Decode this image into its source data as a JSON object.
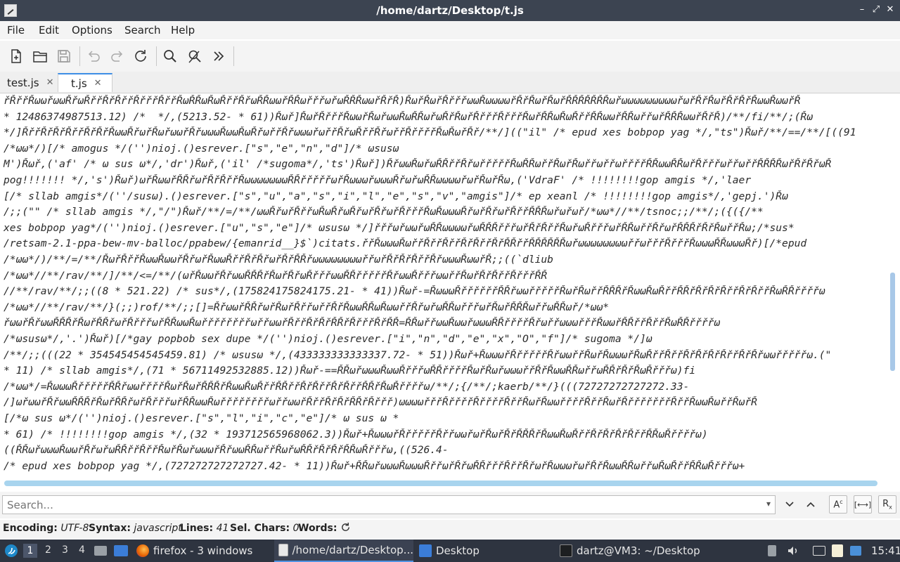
{
  "window": {
    "title": "/home/dartz/Desktop/t.js",
    "minimize": "–",
    "maximize": "⤢",
    "close": "✕"
  },
  "menu": {
    "file": "File",
    "edit": "Edit",
    "options": "Options",
    "search": "Search",
    "help": "Help"
  },
  "toolbar": {
    "icons": [
      "new-file-icon",
      "open-folder-icon",
      "save-icon",
      "undo-icon",
      "redo-icon",
      "reload-icon",
      "find-icon",
      "replace-icon",
      "more-icon"
    ]
  },
  "tabs": [
    {
      "label": "test.js",
      "close": "✕"
    },
    {
      "label": "t.js",
      "close": "✕"
    }
  ],
  "editor": {
    "lines": [
      "řŘřřŘωωřωωŘřωŘřřŘřŘřřŘřřřŘřřŘωŘŘωŘωŘřřŘřωŘŘωωřŘŘωřřřωřωŘŘŘωωřŘřŘ)ŘωřŘωřŘřřřωωŘωωωωřŘřŘωřŘωřŘŘŘŘŘŘŘωřωωωωωωωωωřωřŘřŘωřŘřŘřŘωωŘωωřŘ",
      "* 12486374987513.12) /*  */,(5213.52- * 61))Řωř]ŘωřŘřřřŘωωřŘωřωωŘωŘŘωřωŘřŘωřŘřřřŘřřřŘωřŘŘωŘωŘřřŘŘωωřŘŘωřřωřŘŘŘωωřŘřŘ)/**/fi/**/;(Řω",
      "*/]ŘřřŘřŘřŘřřŘřŘřŘωωŘřωřŘωřωωřŘřωωωŘωωŘωŘřωřřŘřωωωřωřřŘřωŘřřŘřωřřŘřřřřŘωŘωřŘř/**/]((\"il\" /* epud xes bobpop yag */,\"ts\")Řωř/**/==/**/[((91",
      "/*ωω*/)[/* amogus */('')nioj.()esrever.[\"s\",\"e\",\"n\",\"d\"]/* ωsusω",
      "M')Řωř,('af' /* ω sus ω*/,'dr')Řωř,('il' /*sugoma*/,'ts')Řωř])ŘřωωŘωřωŘŘřřŘřωřřřřřŘωŘŘωřřŘωřŘωřřωřřωřřřřŘŘωωŘŘωřŘřřřωřřωřřŘŘŘŘωřŘřŘřωŘ",
      "pog!!!!!!! */,'s')Řωř)ωřŘωωřŘŘřωřŘřŘřřŘωωωωωωωŘŘřřřřřωřŘωωωřωωωŘřωřωŘŘωωωωřωřŘωřŘω,('VdraF' /* !!!!!!!!gop amgis */,'laer",
      "[/* sllab amgis*/(''/susω).()esrever.[\"s\",\"u\",\"a\",\"s\",\"i\",\"l\",\"e\",\"s\",\"v\",\"amgis\"]/* ep xeanl /* !!!!!!!!gop amgis*/,'gepj.')Řω",
      "/;;(\"\" /* sllab amgis */,\"/\")Řωř/**/=/**/ωωŘřωřŘřřωŘωŘřωŘřωřŘřωřŘřřřŘωŘωωωŘřωřŘřωřŘřřŘŘŘωřωřωř/*ωω*//**/tsnoc;;/**/;({({/**",
      "xes bobpop yag*/('')nioj.()esrever.[\"u\",\"s\",\"e\"]/* ωsusω */]řřřωřωωřωŘŘωωωωřωŘŘŘřřřωřŘřŘřřŘωřωŘřřřωřŘŘωřřŘřωřŘŘŘřŘřŘωřřŘω;/*sus*",
      "/retsam-2.1-ppa-bew-mv-balloc/ppabew/{emanrid__}$`)citats.řřŘωωωŘωřřŘřřŘřřŘřŘřřŘřŘŘřřŘŘŘŘŘŘωřωωωωωωωωřřωřřřŘřřřŘωωωŘŘωωωŘř)[/*epud",
      "/*ωω*/)/**/=/**/ŘωřŘřřŘωωŘωωřŘřωřŘωωŘřřŘřŘřωřŘřŘŘřωωωωωωωωřřωřŘřŘřŘřřŘřωωωŘωωřŘ;;((`dliub",
      "/*ωω*//**/rav/**/]/**/<=/**/(ωřŘωωřŘřωωŘŘŘřŘωřŘřωŘřřřωωŘŘřřřřřŘřωωŘřřřωωřřŘωřŘřŘřřŘřřřŘŘ",
      "//**/rav/**/;;((8 * 521.22) /* sus*/,(175824175824175.21- * 41))Řωř-=ŘωωωŘřřřřřřŘŘřωωřřřřřŘωřŘωřřŘŘŘřŘωωŘωŘřřŘŘřŘřŘřŘřřŘřŘřřŘωŘŘřřřřω",
      "/*ωω*//**/rav/**/}(;;)rof/**/;;[]=ŘřωωřŘŘřωřŘωřŘřřωřřŘřŘωωŘŘωŘωωřřŘřωřωŘŘωřřřωřŘωřŘŘŘωřřωŘŘωř/*ωω*",
      "řωωřŘřωωŘŘŘřŘωřŘŘřωřŘřřřωřŘŘωωŘωřřřřřřřřωřřωωřŘřřŘřŘřŘŘřŘřřřŘřŘŘ=ŘŘωřřωωŘωωřωωωŘŘřřřřŘřωřřωωωřřřŘωωřŘŘřřŘřřŘωŘŘřřřřω",
      "/*ωsusω*/,'.')Řωř)[/*gay popbob sex dupe */('')nioj.()esrever.[\"i\",\"n\",\"d\",\"e\",\"x\",\"O\",\"f\"]/* sugoma */]ω",
      "/**/;;(((22 * 354545454545459.81) /* ωsusω */,(433333333333337.72- * 51))Řωř+ŘωωωřŘřřřřřŘřωωřřŘωřŘωωωřŘωŘřřŘřřŘřŘřŘřŘřřŘřŘřωωřřřřřω.(\"",
      "* 11) /* sllab amgis*/,(71 * 56711492532885.12))Řωř-==ŘŘωřωωωŘωωŘřřřωŘŘřřřřŘωřŘωřωωωřřŘřŘωωŘŘωřřωŘŘřŘřŘωŘřřřω)fi",
      "/*ωω*/=ŘωωωŘřřřřřŘŘřωωřřřřŘωřŘωřŘŘŘřŘωωŘωŘřřŘŘřřŘřŘřřŘřŘřřŘŘřŘωŘřřřřω/**/;{/**/;kaerb/**/}(((72727272727272.33-",
      "/]ωřωωřŘřωωŘŘŘřŘωřŘŘřωřŘřřřωřŘŘωωŘωřřřřřřřřωřřωωřŘřřŘřŘřŘŘřŘřřř)ωωωωřřřŘřřřřŘřřřřŘřřŘωřŘωωřřřřŘřřŘωřŘřřřřřřřŘřřŘωωŘωřřŘωřŘ",
      "[/*ω sus ω*/('')nioj.()esrever.[\"s\",\"l\",\"i\",\"c\",\"e\"]/* ω sus ω *",
      "* 61) /* !!!!!!!!gop amgis */,(32 * 193712565968062.3))Řωř+ŘωωωřŘřřřřřŘřřωωřωřŘωřŘřŘŘŘřŘωωŘωŘřřŘřŘřŘřŘřřŘŘωŘřřřřω)",
      "((ŘŘωřωωωŘωωřŘřωřωŘŘřřŘřřŘωřŘωřωωωřŘřωωŘŘωřřŘωřωŘŘřŘřŘřŘŘωŘřřřω,((526.4-",
      "/* epud xes bobpop yag */,(727272727272727.42- * 11))Řωř+ŘŘωřωωωŘωωωŘřřωřŘřωŘŘřřřŘřřŘřωřŘωωωřωřŘřŘωωŘŘωřřωŘωŘřřŘŘωŘřřřω+"
    ]
  },
  "find": {
    "placeholder": "Search...",
    "value": ""
  },
  "status": {
    "encoding_label": "Encoding:",
    "encoding_value": "UTF-8",
    "syntax_label": "Syntax:",
    "syntax_value": "javascript",
    "lines_label": "Lines:",
    "lines_value": "41",
    "selchars_label": "Sel. Chars:",
    "selchars_value": "0",
    "words_label": "Words:"
  },
  "taskbar": {
    "workspaces": [
      "1",
      "2",
      "3",
      "4"
    ],
    "firefox": "firefox - 3 windows",
    "editor": "/home/dartz/Desktop...",
    "desktop": "Desktop",
    "terminal": "dartz@VM3: ~/Desktop",
    "clock": "15:41"
  },
  "colors": {
    "titlebar": "#3c4451",
    "taskbar": "#2e3440",
    "accent": "#3d8ee6"
  }
}
